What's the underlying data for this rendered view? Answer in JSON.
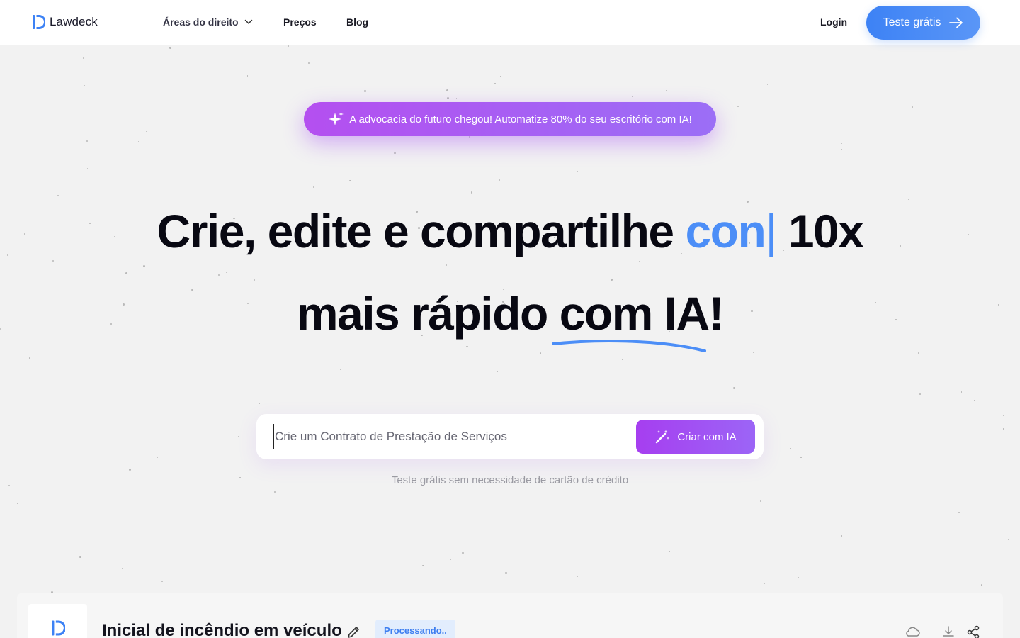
{
  "header": {
    "logo_text": "Lawdeck",
    "nav": {
      "areas": "Áreas do direito",
      "precos": "Preços",
      "blog": "Blog",
      "login": "Login"
    },
    "cta": "Teste grátis"
  },
  "announcement": "A advocacia do futuro chegou! Automatize 80% do seu escritório com IA!",
  "hero": {
    "line1_prefix": "Crie, edite e compartilhe",
    "line1_typed": "con",
    "line1_cursor": "|",
    "line1_suffix": "10x",
    "line2_prefix": "mais rápido",
    "line2_highlight": "com IA!"
  },
  "search": {
    "placeholder": "Crie um Contrato de Prestação de Serviços",
    "button": "Criar com IA"
  },
  "sub_note": "Teste grátis sem necessidade de cartão de crédito",
  "document": {
    "title": "Inicial de incêndio em veículo",
    "status": "Processando.."
  },
  "colors": {
    "brand_blue": "#3d82f5",
    "brand_purple": "#a63ef0",
    "text_dark": "#080812"
  }
}
